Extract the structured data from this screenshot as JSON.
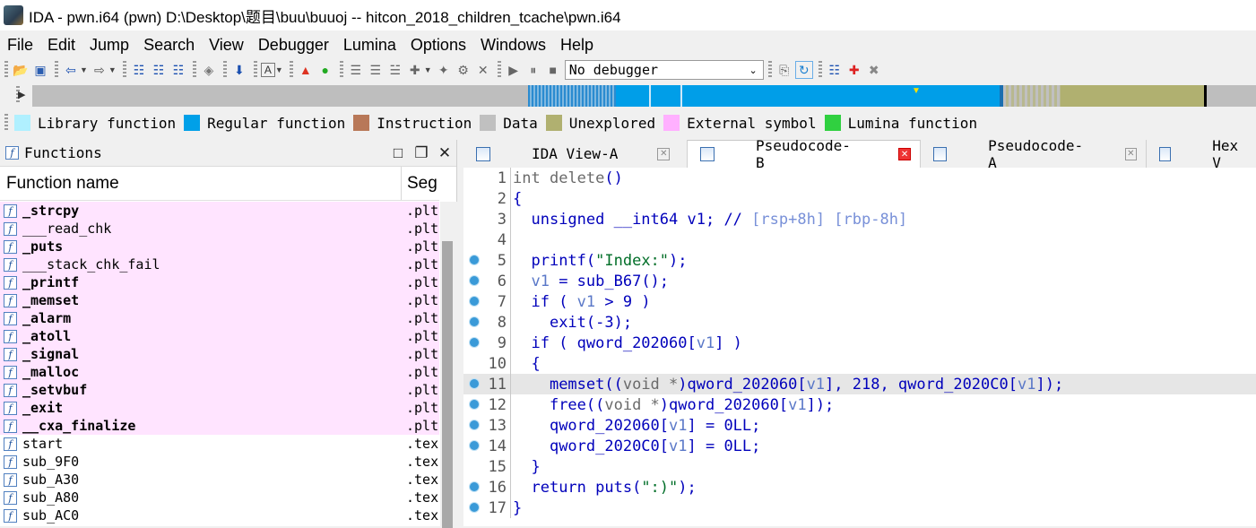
{
  "window": {
    "title": "IDA - pwn.i64 (pwn) D:\\Desktop\\题目\\buu\\buuoj -- hitcon_2018_children_tcache\\pwn.i64"
  },
  "menu": [
    "File",
    "Edit",
    "Jump",
    "Search",
    "View",
    "Debugger",
    "Lumina",
    "Options",
    "Windows",
    "Help"
  ],
  "toolbar": {
    "debugger_select": "No debugger"
  },
  "legend": [
    {
      "label": "Library function",
      "color": "#b0f0ff"
    },
    {
      "label": "Regular function",
      "color": "#00a0e8"
    },
    {
      "label": "Instruction",
      "color": "#b87858"
    },
    {
      "label": "Data",
      "color": "#c0c0c0"
    },
    {
      "label": "Unexplored",
      "color": "#b0b070"
    },
    {
      "label": "External symbol",
      "color": "#ffb0ff"
    },
    {
      "label": "Lumina function",
      "color": "#30d040"
    }
  ],
  "functions_panel": {
    "title": "Functions",
    "col_name": "Function name",
    "col_segment": "Seg",
    "rows": [
      {
        "name": "_strcpy",
        "seg": ".plt",
        "bold": true,
        "pink": true
      },
      {
        "name": "___read_chk",
        "seg": ".plt",
        "bold": false,
        "pink": true
      },
      {
        "name": "_puts",
        "seg": ".plt",
        "bold": true,
        "pink": true
      },
      {
        "name": "___stack_chk_fail",
        "seg": ".plt",
        "bold": false,
        "pink": true
      },
      {
        "name": "_printf",
        "seg": ".plt",
        "bold": true,
        "pink": true
      },
      {
        "name": "_memset",
        "seg": ".plt",
        "bold": true,
        "pink": true
      },
      {
        "name": "_alarm",
        "seg": ".plt",
        "bold": true,
        "pink": true
      },
      {
        "name": "_atoll",
        "seg": ".plt",
        "bold": true,
        "pink": true
      },
      {
        "name": "_signal",
        "seg": ".plt",
        "bold": true,
        "pink": true
      },
      {
        "name": "_malloc",
        "seg": ".plt",
        "bold": true,
        "pink": true
      },
      {
        "name": "_setvbuf",
        "seg": ".plt",
        "bold": true,
        "pink": true
      },
      {
        "name": "_exit",
        "seg": ".plt",
        "bold": true,
        "pink": true
      },
      {
        "name": "__cxa_finalize",
        "seg": ".plt",
        "bold": true,
        "pink": true
      },
      {
        "name": "start",
        "seg": ".text",
        "bold": false,
        "pink": false
      },
      {
        "name": "sub_9F0",
        "seg": ".text",
        "bold": false,
        "pink": false
      },
      {
        "name": "sub_A30",
        "seg": ".text",
        "bold": false,
        "pink": false
      },
      {
        "name": "sub_A80",
        "seg": ".text",
        "bold": false,
        "pink": false
      },
      {
        "name": "sub_AC0",
        "seg": ".text",
        "bold": false,
        "pink": false
      }
    ]
  },
  "tabs": [
    {
      "label": "IDA View-A",
      "active": false
    },
    {
      "label": "Pseudocode-B",
      "active": true
    },
    {
      "label": "Pseudocode-A",
      "active": false
    },
    {
      "label": "Hex V",
      "active": false
    }
  ],
  "code": {
    "line_numbers": [
      "1",
      "2",
      "3",
      "4",
      "5",
      "6",
      "7",
      "8",
      "9",
      "10",
      "11",
      "12",
      "13",
      "14",
      "15",
      "16",
      "17"
    ],
    "l1": {
      "kw": "int",
      "name": "delete",
      "paren": "()"
    },
    "l2": "{",
    "l3": {
      "decl": "unsigned __int64 v1;",
      "comment": "//",
      "regs": "[rsp+8h] [rbp-8h]"
    },
    "l5": {
      "fn": "printf(",
      "str": "\"Index:\"",
      "end": ");"
    },
    "l6": {
      "var": "v1",
      "rest": " = sub_B67();"
    },
    "l7": {
      "pre": "if ( ",
      "var": "v1",
      "rest": " > 9 )"
    },
    "l8": {
      "fn": "exit(-3);"
    },
    "l9": {
      "pre": "if ( qword_202060[",
      "var": "v1",
      "rest": "] )"
    },
    "l10": "{",
    "l11": {
      "a": "memset((",
      "cast": "void *",
      "b": ")qword_202060[",
      "v1": "v1",
      "c": "], 218, qword_2020C0[",
      "v2": "v1",
      "d": "]);"
    },
    "l12": {
      "a": "free((",
      "cast": "void *",
      "b": ")qword_202060[",
      "v1": "v1",
      "c": "]);"
    },
    "l13": {
      "a": "qword_202060[",
      "v1": "v1",
      "b": "] = 0LL;"
    },
    "l14": {
      "a": "qword_2020C0[",
      "v1": "v1",
      "b": "] = 0LL;"
    },
    "l15": "}",
    "l16": {
      "a": "return puts(",
      "str": "\":)\"",
      "b": ");"
    },
    "l17": "}"
  }
}
